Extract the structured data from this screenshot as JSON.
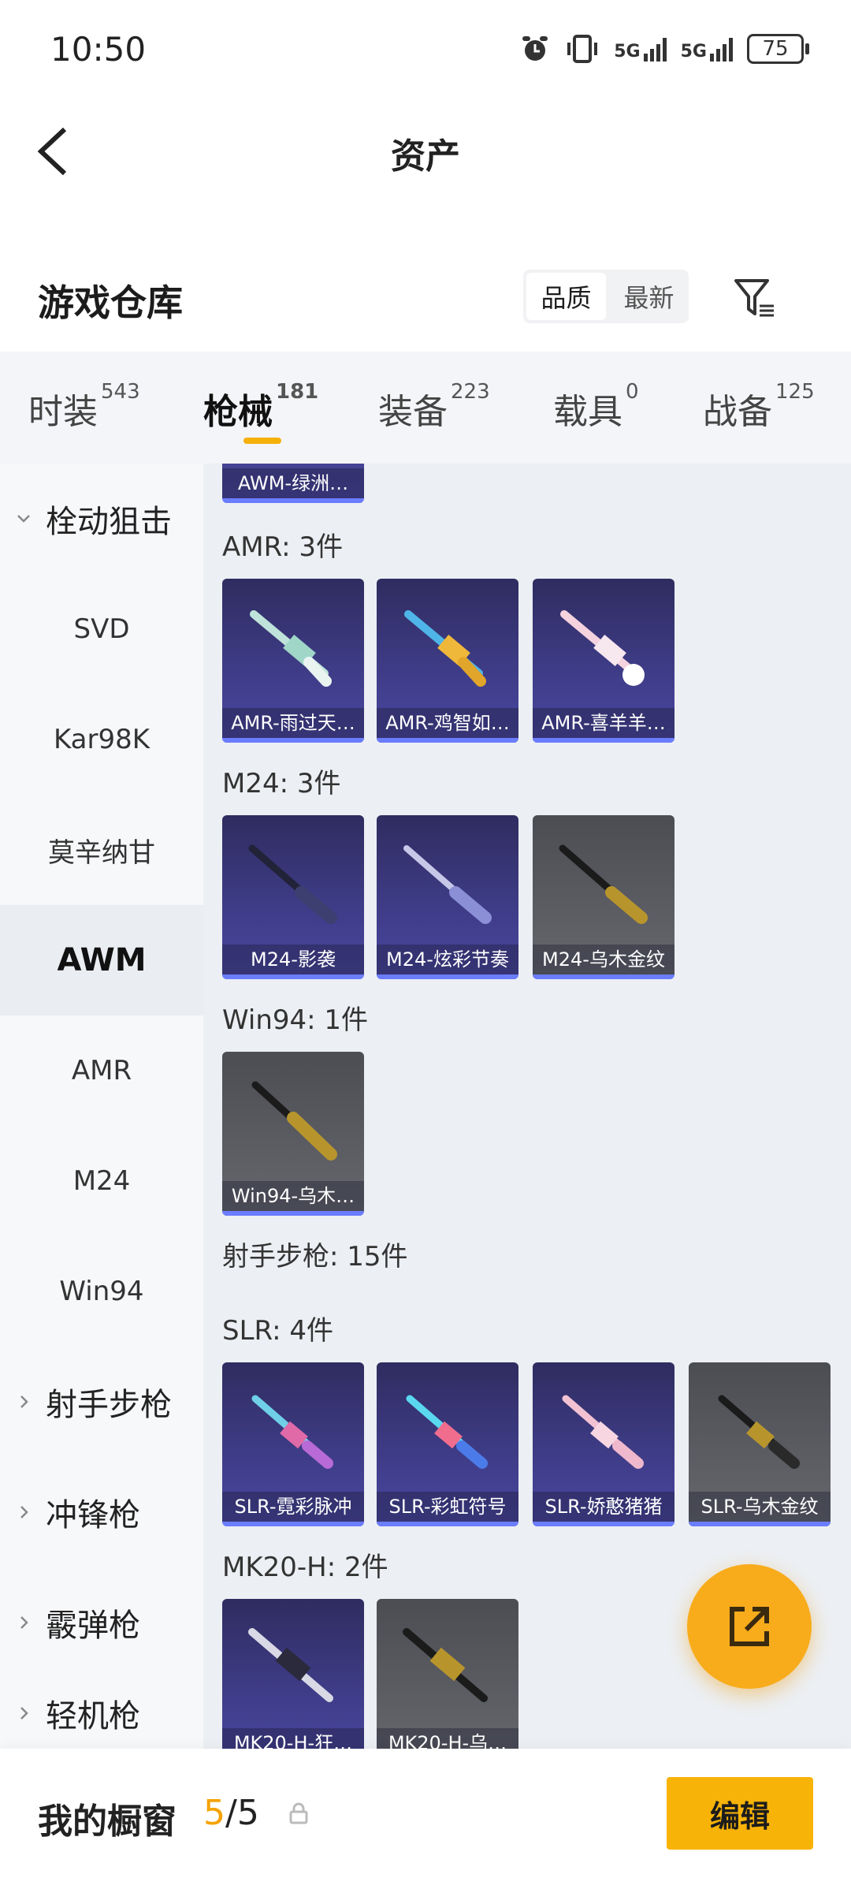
{
  "status_bar": {
    "time": "10:50",
    "battery": "75",
    "sig1": "5G",
    "sig2": "5G"
  },
  "header": {
    "title": "资产"
  },
  "section": {
    "title": "游戏仓库",
    "sort_options": [
      "品质",
      "最新"
    ]
  },
  "tabs": [
    {
      "label": "时装",
      "count": "543"
    },
    {
      "label": "枪械",
      "count": "181"
    },
    {
      "label": "装备",
      "count": "223"
    },
    {
      "label": "载具",
      "count": "0"
    },
    {
      "label": "战备",
      "count": "125"
    }
  ],
  "sidebar": [
    "栓动狙击",
    "SVD",
    "Kar98K",
    "莫辛纳甘",
    "AWM",
    "AMR",
    "M24",
    "Win94",
    "射手步枪",
    "冲锋枪",
    "霰弹枪",
    "轻机枪"
  ],
  "groups": {
    "awm_partial": "AWM-绿洲…",
    "amr": {
      "label": "AMR: 3件",
      "items": [
        "AMR-雨过天…",
        "AMR-鸡智如…",
        "AMR-喜羊羊…"
      ]
    },
    "m24": {
      "label": "M24: 3件",
      "items": [
        "M24-影袭",
        "M24-炫彩节奏",
        "M24-乌木金纹"
      ]
    },
    "win94": {
      "label": "Win94: 1件",
      "items": [
        "Win94-乌木…"
      ]
    },
    "marksman": {
      "label": "射手步枪: 15件"
    },
    "slr": {
      "label": "SLR: 4件",
      "items": [
        "SLR-霓彩脉冲",
        "SLR-彩虹符号",
        "SLR-娇憨猪猪",
        "SLR-乌木金纹"
      ]
    },
    "mk20": {
      "label": "MK20-H: 2件",
      "items": [
        "MK20-H-狂…",
        "MK20-H-乌…"
      ]
    }
  },
  "bottom_bar": {
    "label": "我的橱窗",
    "current": "5",
    "total": "/5",
    "edit_label": "编辑"
  }
}
